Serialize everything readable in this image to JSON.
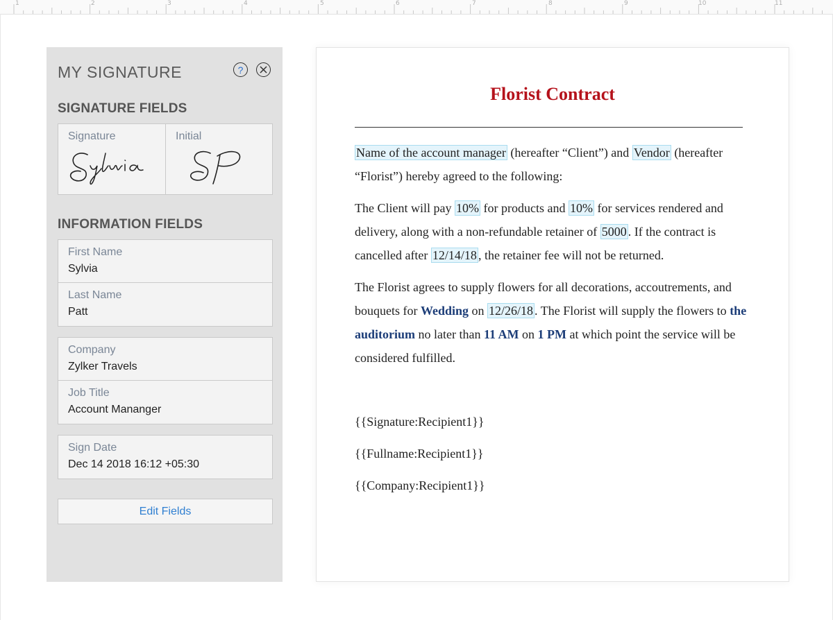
{
  "ruler": {
    "numbers": [
      "1",
      "2",
      "3",
      "4",
      "5",
      "6",
      "7",
      "8",
      "9",
      "10",
      "11"
    ]
  },
  "panel": {
    "title": "MY SIGNATURE",
    "help_icon": "help-icon",
    "close_icon": "close-icon",
    "signature_section": "SIGNATURE FIELDS",
    "signature_label": "Signature",
    "initial_label": "Initial",
    "information_section": "INFORMATION FIELDS",
    "fields": {
      "first_name": {
        "label": "First Name",
        "value": "Sylvia"
      },
      "last_name": {
        "label": "Last Name",
        "value": "Patt"
      },
      "company": {
        "label": "Company",
        "value": "Zylker Travels"
      },
      "job_title": {
        "label": "Job Title",
        "value": "Account Mananger"
      },
      "sign_date": {
        "label": "Sign Date",
        "value": "Dec 14 2018 16:12 +05:30"
      }
    },
    "edit_button": "Edit Fields"
  },
  "document": {
    "title": "Florist Contract",
    "title_color": "#b5121b",
    "p1": {
      "account_manager": "Name of the account manager",
      "t1": " (hereafter “Client”) and ",
      "vendor": "Vendor",
      "t2": " (hereafter “Florist”) hereby agreed to the following:"
    },
    "p2": {
      "t1": "The Client will pay ",
      "pct1": "10%",
      "t2": " for products and ",
      "pct2": "10%",
      "t3": " for services rendered and delivery, along with a non-refundable retainer of ",
      "retainer": "5000",
      "t4": ". If the contract is cancelled after ",
      "date1": "12/14/18",
      "t5": ", the retainer fee will not be returned."
    },
    "p3": {
      "t1": "The Florist agrees to supply flowers for all decorations, accoutrements, and bouquets for ",
      "event": "Wedding",
      "t2": " on ",
      "date2": "12/26/18",
      "t3": ". The Florist will supply the flowers to ",
      "venue": "the auditorium",
      "t4": " no later than ",
      "time1": "11 AM",
      "t5": " on ",
      "time2": "1 PM",
      "t6": " at which point the service will be considered fulfilled."
    },
    "placeholders": [
      "{{Signature:Recipient1}}",
      "{{Fullname:Recipient1}}",
      "{{Company:Recipient1}}"
    ]
  }
}
